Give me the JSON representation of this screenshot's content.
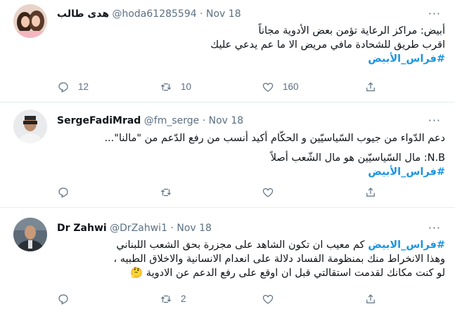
{
  "tweets": [
    {
      "name": "هدى طالب",
      "handle": "@hoda61285594",
      "dot": "·",
      "time": "Nov 18",
      "lines": [
        "أبيض: مراكز الرعاية تؤمن بعض الأدوية مجاناً",
        "اقرب طريق للشحادة مافي مريض الا ما عم يدعي عليك"
      ],
      "hashtag": "#فراس_الأبيض",
      "reply_count": "12",
      "retweet_count": "10",
      "like_count": "160"
    },
    {
      "name": "SergeFadiMrad",
      "handle": "@fm_serge",
      "dot": "·",
      "time": "Nov 18",
      "lines": [
        "دعم الدّواء من جيوب السّياسيّين و الحكّام أكيد أنسب من رفع الدّعم من \"مالنا\"...",
        "N.B: مال السّياسيّين هو مال الشّعب أصلاً"
      ],
      "hashtag": "#فراس_الأبيض",
      "reply_count": "",
      "retweet_count": "",
      "like_count": ""
    },
    {
      "name": "Dr Zahwi",
      "handle": "@DrZahwi1",
      "dot": "·",
      "time": "Nov 18",
      "first_hashtag": "#فراس_الابيض",
      "first_line_rest": " كم معيب ان تكون الشاهد على مجزرة بحق الشعب اللبناني",
      "lines": [
        "وهذا الانخراط منك بمنظومة الفساد دلالة على انعدام الانسانية والاخلاق الطبيه ،",
        "لو كنت مكانك لقدمت استقالتي قبل ان اوقع على رفع الدعم عن الادوية 🤔"
      ],
      "reply_count": "",
      "retweet_count": "2",
      "like_count": ""
    }
  ],
  "more_label": "···",
  "colors": {
    "hashtag": "#1b95e0",
    "muted": "#5b7083",
    "divider": "#e6ecf0"
  }
}
